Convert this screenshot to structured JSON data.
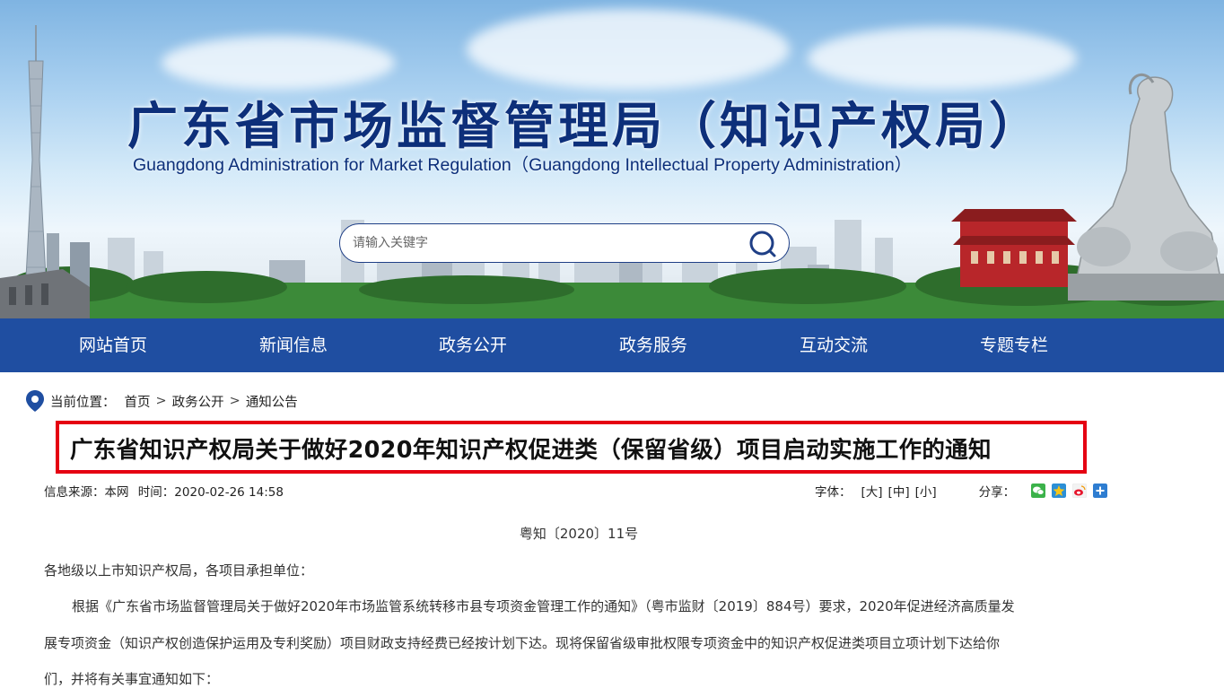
{
  "header": {
    "title_cn": "广东省市场监督管理局（知识产权局）",
    "title_en": "Guangdong Administration for Market Regulation（Guangdong Intellectual Property Administration）"
  },
  "search": {
    "placeholder": "请输入关键字",
    "icon": "search-icon"
  },
  "nav": {
    "items": [
      {
        "label": "网站首页"
      },
      {
        "label": "新闻信息"
      },
      {
        "label": "政务公开"
      },
      {
        "label": "政务服务"
      },
      {
        "label": "互动交流"
      },
      {
        "label": "专题专栏"
      }
    ]
  },
  "breadcrumb": {
    "label": "当前位置：",
    "items": [
      "首页",
      "政务公开",
      "通知公告"
    ],
    "separator": ">"
  },
  "article": {
    "title": "广东省知识产权局关于做好2020年知识产权促进类（保留省级）项目启动实施工作的通知",
    "source": "信息来源：本网",
    "time": "时间：2020-02-26 14:58",
    "font_label": "字体：",
    "font_sizes": [
      "[大]",
      "[中]",
      "[小]"
    ],
    "share_label": "分享：",
    "share_icons": [
      "wechat-icon",
      "qzone-icon",
      "weibo-icon",
      "more-share-icon"
    ],
    "doc_number": "粤知〔2020〕11号",
    "salutation": "各地级以上市知识产权局，各项目承担单位：",
    "body_lines": [
      "根据《广东省市场监督管理局关于做好2020年市场监管系统转移市县专项资金管理工作的通知》（粤市监财〔2019〕884号）要求，2020年促进经济高质量发",
      "展专项资金（知识产权创造保护运用及专利奖励）项目财政支持经费已经按计划下达。现将保留省级审批权限专项资金中的知识产权促进类项目立项计划下达给你",
      "们，并将有关事宜通知如下："
    ]
  },
  "colors": {
    "nav_bg": "#1f4ea1",
    "title_color": "#0d2f7a",
    "highlight_border": "#e50012"
  }
}
